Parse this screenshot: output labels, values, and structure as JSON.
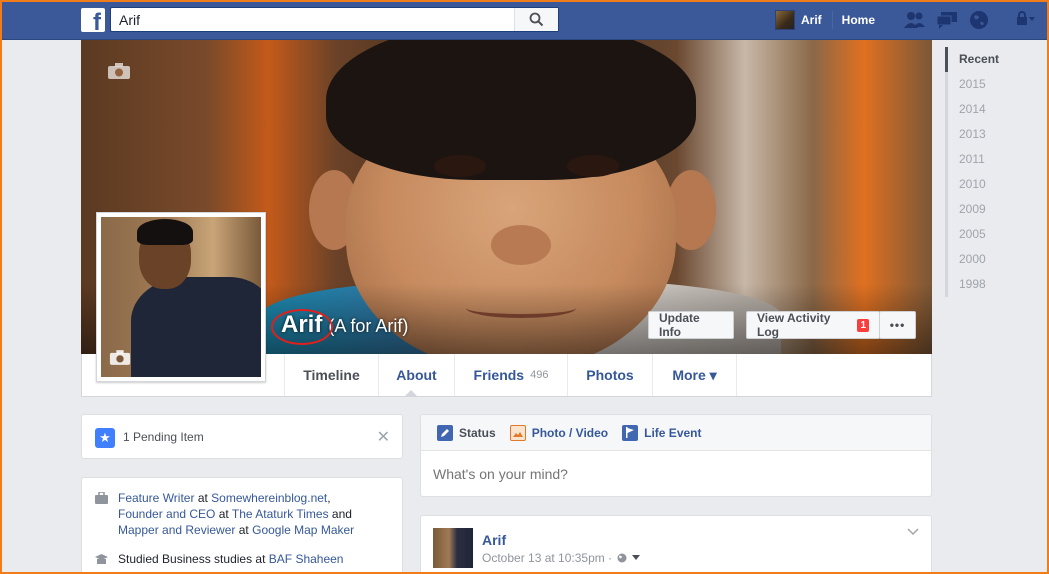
{
  "topbar": {
    "search_value": "Arif",
    "user_name": "Arif",
    "home_label": "Home"
  },
  "profile": {
    "name": "Arif",
    "alternate_name": "(A for Arif)",
    "update_info_label": "Update Info",
    "activity_log_label": "View Activity Log",
    "activity_log_badge": "1",
    "more_options_label": "•••"
  },
  "nav": {
    "tabs": [
      {
        "label": "Timeline"
      },
      {
        "label": "About"
      },
      {
        "label": "Friends",
        "count": "496"
      },
      {
        "label": "Photos"
      },
      {
        "label": "More ▾"
      }
    ]
  },
  "timeline_years": [
    "Recent",
    "2015",
    "2014",
    "2013",
    "2011",
    "2010",
    "2009",
    "2005",
    "2000",
    "1998"
  ],
  "pending": {
    "text": "1 Pending Item",
    "close": "✕"
  },
  "intro": {
    "work": [
      {
        "role": "Feature Writer",
        "at": "at",
        "place": "Somewhereinblog.net",
        "sep": ","
      },
      {
        "role": "Founder and CEO",
        "at": "at",
        "place": "The Ataturk Times",
        "sep": "and"
      },
      {
        "role": "Mapper and Reviewer",
        "at": "at",
        "place": "Google Map Maker",
        "sep": ""
      }
    ],
    "education_prefix": "Studied Business studies at",
    "education_place": "BAF Shaheen"
  },
  "composer": {
    "tabs": [
      {
        "label": "Status"
      },
      {
        "label": "Photo / Video"
      },
      {
        "label": "Life Event"
      }
    ],
    "placeholder": "What's on your mind?"
  },
  "post": {
    "author": "Arif",
    "timestamp": "October 13 at 10:35pm · "
  },
  "colors": {
    "brand": "#3b5998",
    "link": "#365899",
    "badge": "#fa3e3e",
    "highlight_circle": "#e0201a",
    "frame": "#f07c1a"
  }
}
